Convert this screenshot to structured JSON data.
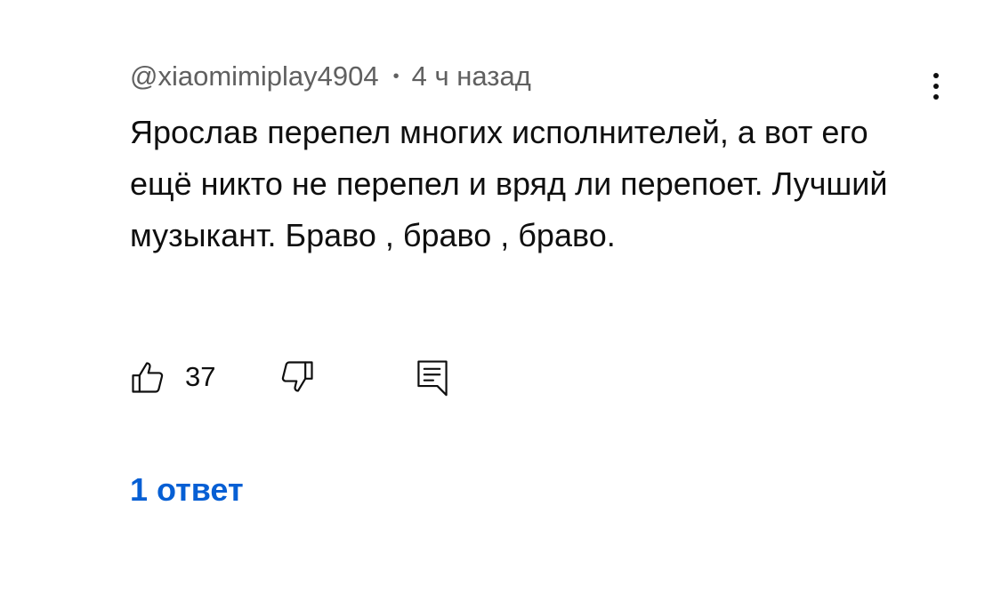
{
  "comment": {
    "author": "@xiaomimiplay4904",
    "separator": "•",
    "time": "4 ч назад",
    "text": "Ярослав перепел многих исполнителей, а вот его ещё никто не перепел и вряд ли перепоет. Лучший музыкант. Браво , браво , браво.",
    "like_count": "37",
    "replies_label": "1 ответ"
  },
  "icons": {
    "like": "thumbs-up-icon",
    "dislike": "thumbs-down-icon",
    "reply": "reply-comment-icon",
    "menu": "more-vertical-icon"
  },
  "colors": {
    "meta_text": "#606060",
    "body_text": "#0f0f0f",
    "replies_link": "#065fd4",
    "background": "#ffffff"
  }
}
